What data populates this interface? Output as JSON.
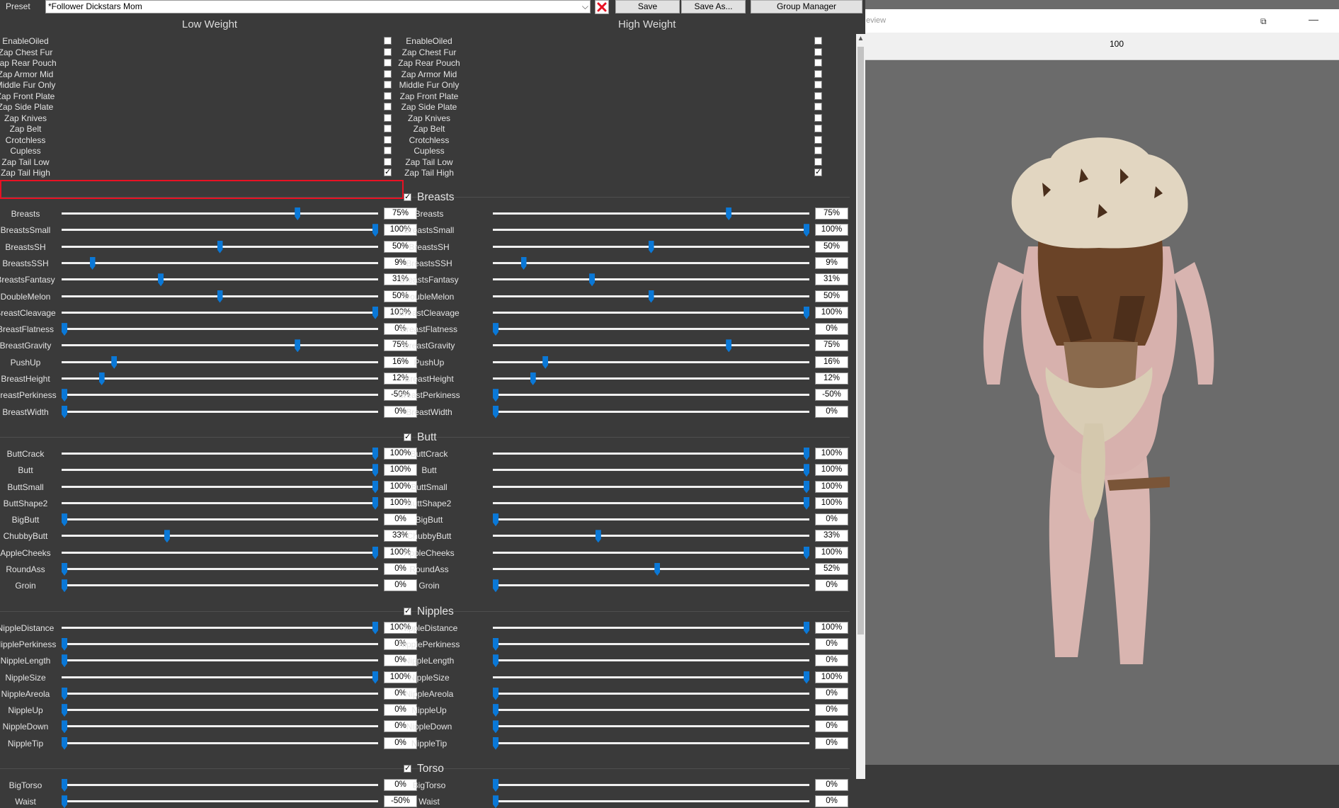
{
  "toolbar": {
    "preset_label": "Preset",
    "preset_value": "*Follower Dickstars Mom",
    "save": "Save",
    "save_as": "Save As...",
    "group_manager": "Group Manager"
  },
  "columns": {
    "low": "Low Weight",
    "high": "High Weight"
  },
  "checkboxes": [
    {
      "label": "EnableOiled",
      "low": false,
      "high": false
    },
    {
      "label": "Zap Chest Fur",
      "low": false,
      "high": false
    },
    {
      "label": "Zap Rear Pouch",
      "low": false,
      "high": false
    },
    {
      "label": "Zap Armor Mid",
      "low": false,
      "high": false
    },
    {
      "label": "Middle Fur Only",
      "low": false,
      "high": false
    },
    {
      "label": "Zap Front Plate",
      "low": false,
      "high": false
    },
    {
      "label": "Zap Side Plate",
      "low": false,
      "high": false
    },
    {
      "label": "Zap Knives",
      "low": false,
      "high": false
    },
    {
      "label": "Zap Belt",
      "low": false,
      "high": false
    },
    {
      "label": "Crotchless",
      "low": false,
      "high": false
    },
    {
      "label": "Cupless",
      "low": false,
      "high": false
    },
    {
      "label": "Zap Tail Low",
      "low": false,
      "high": false
    },
    {
      "label": "Zap Tail High",
      "low": true,
      "high": true
    }
  ],
  "sections": [
    {
      "title": "Breasts",
      "checked": true,
      "sliders": [
        {
          "label": "Breasts",
          "low": 75,
          "high": 75
        },
        {
          "label": "BreastsSmall",
          "low": 100,
          "high": 100
        },
        {
          "label": "BreastsSH",
          "low": 50,
          "high": 50
        },
        {
          "label": "BreastsSSH",
          "low": 9,
          "high": 9
        },
        {
          "label": "BreastsFantasy",
          "low": 31,
          "high": 31
        },
        {
          "label": "DoubleMelon",
          "low": 50,
          "high": 50
        },
        {
          "label": "BreastCleavage",
          "low": 100,
          "high": 100
        },
        {
          "label": "BreastFlatness",
          "low": 0,
          "high": 0
        },
        {
          "label": "BreastGravity",
          "low": 75,
          "high": 75
        },
        {
          "label": "PushUp",
          "low": 16,
          "high": 16
        },
        {
          "label": "BreastHeight",
          "low": 12,
          "high": 12
        },
        {
          "label": "BreastPerkiness",
          "low": -50,
          "high": -50
        },
        {
          "label": "BreastWidth",
          "low": 0,
          "high": 0
        }
      ]
    },
    {
      "title": "Butt",
      "checked": true,
      "sliders": [
        {
          "label": "ButtCrack",
          "low": 100,
          "high": 100
        },
        {
          "label": "Butt",
          "low": 100,
          "high": 100
        },
        {
          "label": "ButtSmall",
          "low": 100,
          "high": 100
        },
        {
          "label": "ButtShape2",
          "low": 100,
          "high": 100
        },
        {
          "label": "BigButt",
          "low": 0,
          "high": 0
        },
        {
          "label": "ChubbyButt",
          "low": 33,
          "high": 33
        },
        {
          "label": "AppleCheeks",
          "low": 100,
          "high": 100
        },
        {
          "label": "RoundAss",
          "low": 0,
          "high": 52
        },
        {
          "label": "Groin",
          "low": 0,
          "high": 0
        }
      ]
    },
    {
      "title": "Nipples",
      "checked": true,
      "sliders": [
        {
          "label": "NippleDistance",
          "low": 100,
          "high": 100
        },
        {
          "label": "NipplePerkiness",
          "low": 0,
          "high": 0
        },
        {
          "label": "NippleLength",
          "low": 0,
          "high": 0
        },
        {
          "label": "NippleSize",
          "low": 100,
          "high": 100
        },
        {
          "label": "NippleAreola",
          "low": 0,
          "high": 0
        },
        {
          "label": "NippleUp",
          "low": 0,
          "high": 0
        },
        {
          "label": "NippleDown",
          "low": 0,
          "high": 0
        },
        {
          "label": "NippleTip",
          "low": 0,
          "high": 0
        }
      ]
    },
    {
      "title": "Torso",
      "checked": true,
      "sliders": [
        {
          "label": "BigTorso",
          "low": 0,
          "high": 0
        },
        {
          "label": "Waist",
          "low": -50,
          "high": 0
        }
      ]
    }
  ],
  "preview": {
    "title": "eview",
    "zoom": "100"
  },
  "colors": {
    "slider_thumb": "#0a78d7",
    "highlight": "#e81123",
    "panel_bg": "#3a3a3a",
    "viewport_bg": "#6b6b6b"
  }
}
